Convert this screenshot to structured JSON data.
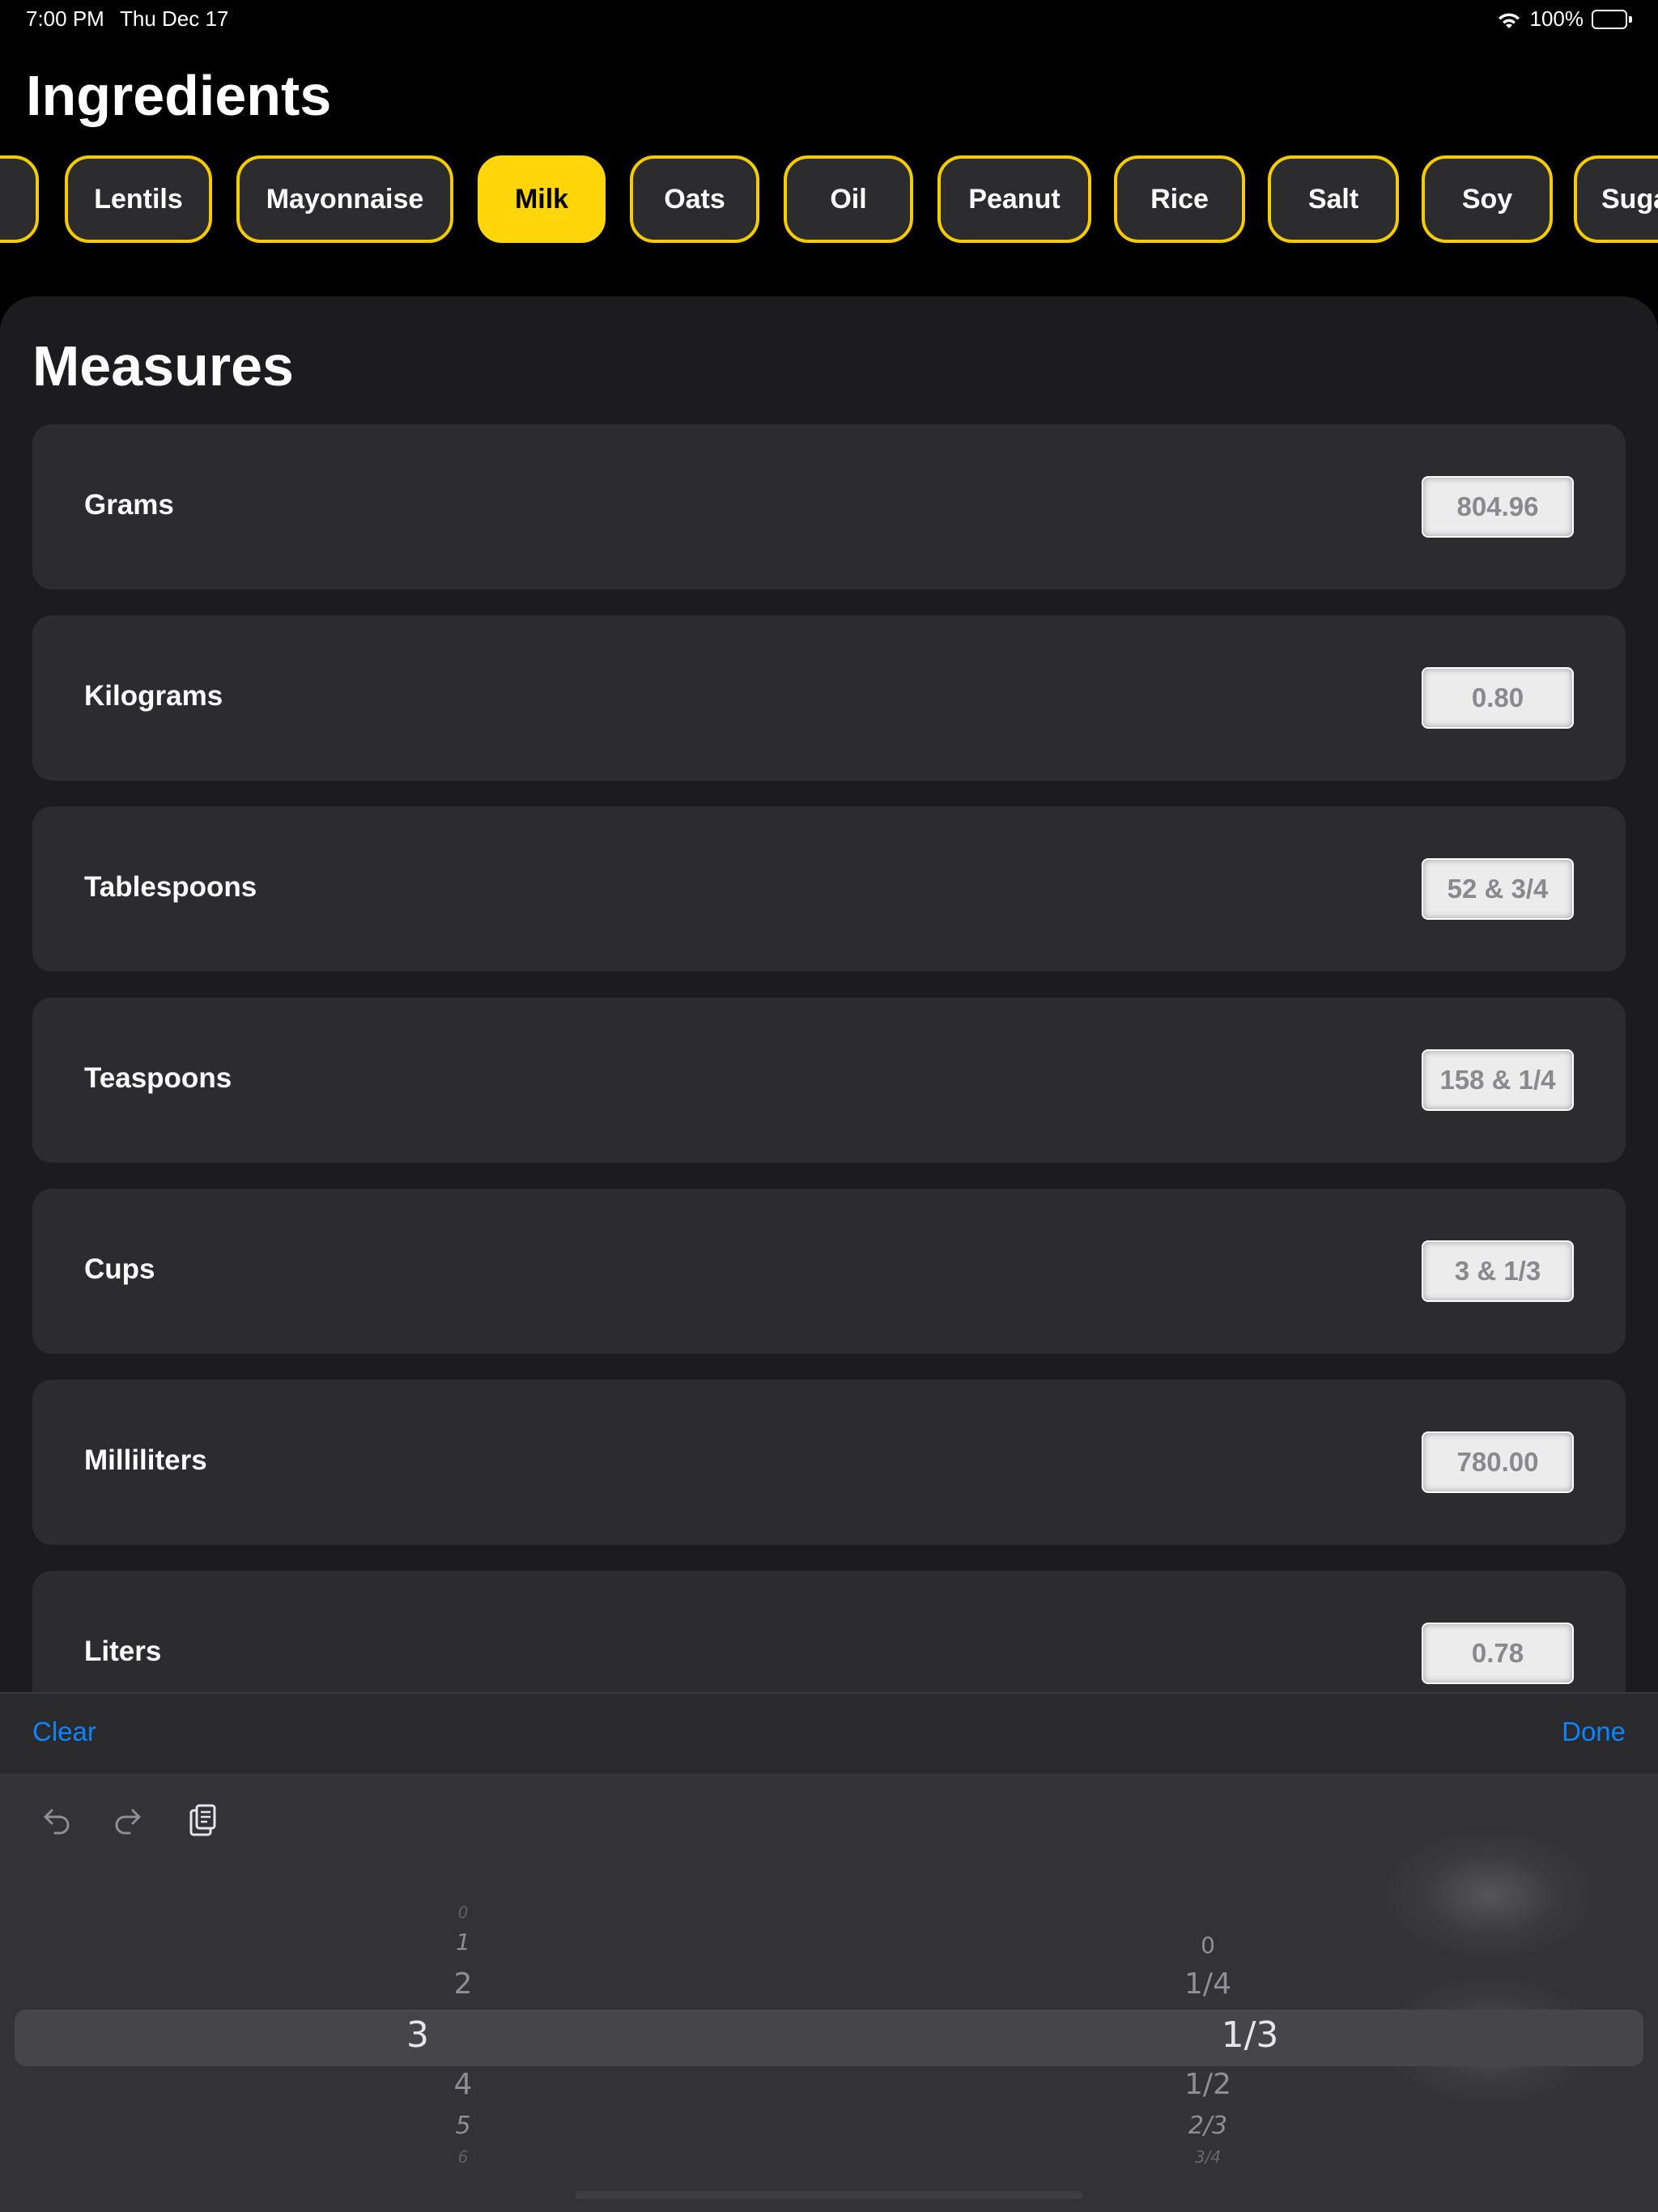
{
  "status_bar": {
    "time": "7:00 PM",
    "date": "Thu Dec 17",
    "battery": "100%",
    "icons": [
      "wifi-icon",
      "battery-icon"
    ]
  },
  "page": {
    "title": "Ingredients"
  },
  "chips": [
    {
      "label": ""
    },
    {
      "label": "Lentils"
    },
    {
      "label": "Mayonnaise"
    },
    {
      "label": "Milk",
      "selected": true
    },
    {
      "label": "Oats"
    },
    {
      "label": "Oil"
    },
    {
      "label": "Peanut"
    },
    {
      "label": "Rice"
    },
    {
      "label": "Salt"
    },
    {
      "label": "Soy"
    },
    {
      "label": "Suga"
    }
  ],
  "measures": {
    "title": "Measures",
    "rows": [
      {
        "label": "Grams",
        "value": "804.96"
      },
      {
        "label": "Kilograms",
        "value": "0.80"
      },
      {
        "label": "Tablespoons",
        "value": "52 & 3/4"
      },
      {
        "label": "Teaspoons",
        "value": "158 & 1/4"
      },
      {
        "label": "Cups",
        "value": "3 & 1/3"
      },
      {
        "label": "Milliliters",
        "value": "780.00"
      },
      {
        "label": "Liters",
        "value": "0.78"
      }
    ]
  },
  "keyboard_toolbar": {
    "clear_label": "Clear",
    "done_label": "Done"
  },
  "shortcut_icons": [
    "undo-icon",
    "redo-icon",
    "paste-icon"
  ],
  "picker": {
    "whole": [
      "0",
      "1",
      "2",
      "3",
      "4",
      "5",
      "6"
    ],
    "fraction": [
      "0",
      "1/4",
      "1/3",
      "1/2",
      "2/3",
      "3/4"
    ],
    "whole_selected": "3",
    "fraction_selected": "1/3"
  },
  "colors": {
    "accent": "#ffd60a",
    "link": "#0a84ff",
    "background": "#000000",
    "sheet": "#1c1c1e",
    "card": "#2c2c2e"
  }
}
